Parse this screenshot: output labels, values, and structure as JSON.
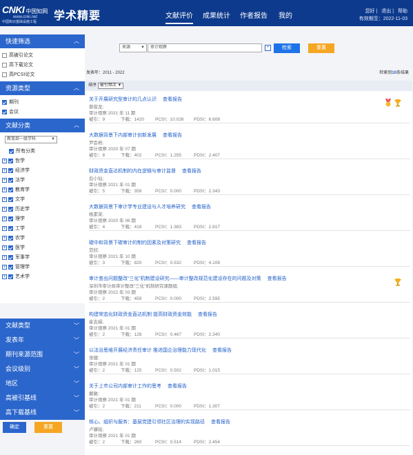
{
  "header": {
    "logo_main": "CNKI",
    "logo_cn": "中国知网",
    "logo_url": "www.cnki.net",
    "logo_sub": "中国知识基础设施工程",
    "app_title": "学术精要",
    "nav": [
      "文献评价",
      "成果统计",
      "作者报告",
      "我的"
    ],
    "user_links": [
      "您好",
      "退出",
      "帮助"
    ],
    "valid_until": "有效期至：2022-11-03"
  },
  "sidebar": {
    "quick_filter": {
      "title": "快速筛选",
      "items": [
        "高被引论文",
        "高下载论文",
        "高PCSI论文"
      ]
    },
    "resource_type": {
      "title": "资源类型",
      "items": [
        "期刊",
        "会议"
      ]
    },
    "doc_category": {
      "title": "文献分类",
      "select": "教育部一级学科",
      "all_label": "所有分类",
      "items": [
        "哲学",
        "经济学",
        "法学",
        "教育学",
        "文学",
        "历史学",
        "理学",
        "工学",
        "农学",
        "医学",
        "军事学",
        "管理学",
        "艺术学"
      ]
    },
    "more_sections": [
      "文献类型",
      "发表年",
      "期刊来源范围",
      "会议级别",
      "地区",
      "高被引基线",
      "高下载基线"
    ],
    "confirm_label": "确定",
    "reset_label": "重置"
  },
  "search": {
    "field_select": "来源",
    "query": "审计观察",
    "search_label": "检索",
    "reset_label": "重置"
  },
  "info": {
    "year_range": "发表年：2011 - 2022",
    "result_prefix": "检索到",
    "result_count": "10",
    "result_suffix": "条结果"
  },
  "sort": {
    "label": "排序",
    "value": "被引频次"
  },
  "colors": {
    "header": "#0d3a8c",
    "accent": "#2b66cc",
    "search_btn": "#1e73e8",
    "reset_btn": "#f5a623",
    "link": "#1f5ec8"
  },
  "results": [
    {
      "title": "关于开展研究型审计的几点认识",
      "report": "查看报告",
      "author": "蔡俊龙;",
      "source": "审计观察 2021 年 11 期",
      "cites": "被引：9",
      "downloads": "下载：1420",
      "pcsi": "PCSI：10.026",
      "pdsi": "PDSI：6.608",
      "badges": [
        "medal-icon",
        "trophy-icon"
      ]
    },
    {
      "title": "大数据背景下内部审计创新发展",
      "report": "查看报告",
      "author": "尹会岩;",
      "source": "审计观察 2020 年 07 期",
      "cites": "被引：8",
      "downloads": "下载：402",
      "pcsi": "PCSI：1.255",
      "pdsi": "PDSI：2.407",
      "badges": []
    },
    {
      "title": "财政资金直达机制的内在逻辑与审计监督",
      "report": "查看报告",
      "author": "后小仙;",
      "source": "审计观察 2021 年 01 期",
      "cites": "被引：5",
      "downloads": "下载：359",
      "pcsi": "PCSI：0.000",
      "pdsi": "PDSI：2.343",
      "badges": []
    },
    {
      "title": "大数据背景下审计学专业建设与人才培养研究",
      "report": "查看报告",
      "author": "杨素荣;",
      "source": "审计观察 2020 年 06 期",
      "cites": "被引：4",
      "downloads": "下载：418",
      "pcsi": "PCSI：1.383",
      "pdsi": "PDSI：2.817",
      "badges": []
    },
    {
      "title": "碳中和背景下碳审计的制约因素及对策研究",
      "report": "查看报告",
      "author": "范欣;",
      "source": "审计观察 2021 年 10 期",
      "cites": "被引：3",
      "downloads": "下载：820",
      "pcsi": "PCSI：0.532",
      "pdsi": "PDSI：4.108",
      "badges": []
    },
    {
      "title": "审计查出问题整改“三化”机制建设研究——审计整改规范化建设存在的问题及对策",
      "report": "查看报告",
      "author": "深圳市审计局审计整改“三化”机制研究课题组;",
      "source": "审计观察 2022 年 03 期",
      "cites": "被引：2",
      "downloads": "下载：459",
      "pcsi": "PCSI：0.000",
      "pdsi": "PDSI：2.595",
      "badges": [
        "trophy-icon"
      ]
    },
    {
      "title": "构建常态化财政资金直达机制 提高财政资金效能",
      "report": "查看报告",
      "author": "崔志娟;",
      "source": "审计观察 2021 年 01 期",
      "cites": "被引：2",
      "downloads": "下载：128",
      "pcsi": "PCSI：0.467",
      "pdsi": "PDSI：2.340",
      "badges": []
    },
    {
      "title": "以法治思维开展经济责任审计 推进国企治理能力现代化",
      "report": "查看报告",
      "author": "张健;",
      "source": "审计观察 2021 年 01 期",
      "cites": "被引：2",
      "downloads": "下载：125",
      "pcsi": "PCSI：0.502",
      "pdsi": "PDSI：1.015",
      "badges": []
    },
    {
      "title": "关于上市公司内部审计工作的思考",
      "report": "查看报告",
      "author": "戴敏;",
      "source": "审计观察 2021 年 01 期",
      "cites": "被引：2",
      "downloads": "下载：211",
      "pcsi": "PCSI：0.000",
      "pdsi": "PDSI：1.307",
      "badges": []
    },
    {
      "title": "核心、组织与服务：基层党建引领社区治理的实现路径",
      "report": "查看报告",
      "author": "卢骥铭;",
      "source": "审计观察 2021 年 01 期",
      "cites": "被引：2",
      "downloads": "下载：260",
      "pcsi": "PCSI：0.514",
      "pdsi": "PDSI：2.454",
      "badges": []
    }
  ]
}
